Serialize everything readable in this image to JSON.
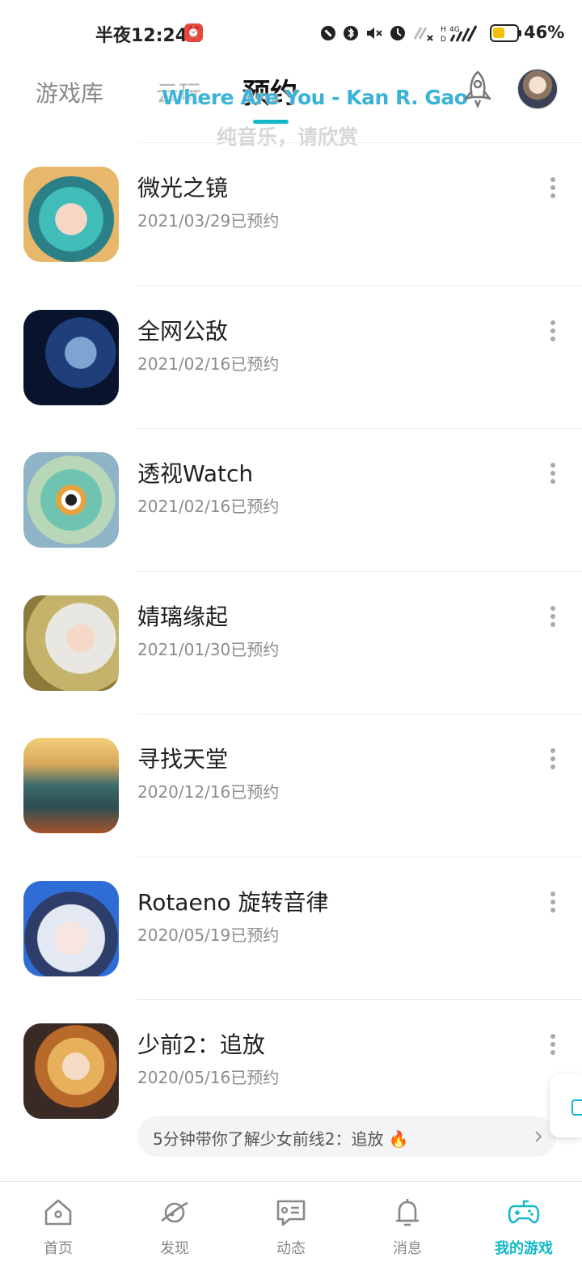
{
  "status_bar": {
    "time": "半夜12:24",
    "network": "4G",
    "battery": "46%",
    "battery_level": 0.46
  },
  "header": {
    "tabs": [
      {
        "label": "游戏库"
      },
      {
        "label": "云玩"
      },
      {
        "label": "预约",
        "active": true
      }
    ],
    "overlay": {
      "title": "Where Are You - Kan R. Gao",
      "subtitle": "纯音乐，请欣赏"
    },
    "rocket_icon": "rocket-icon",
    "avatar_icon": "user-avatar"
  },
  "games": [
    {
      "name": "微光之镜",
      "date": "2021/03/29已预约"
    },
    {
      "name": "全网公敌",
      "date": "2021/02/16已预约"
    },
    {
      "name": "透视Watch",
      "date": "2021/02/16已预约"
    },
    {
      "name": "婧璃缘起",
      "date": "2021/01/30已预约"
    },
    {
      "name": "寻找天堂",
      "date": "2020/12/16已预约"
    },
    {
      "name": "Rotaeno 旋转音律",
      "date": "2020/05/19已预约"
    },
    {
      "name": "少前2：追放",
      "date": "2020/05/16已预约"
    }
  ],
  "promo": {
    "text": "5分钟带你了解少女前线2：追放 🔥"
  },
  "bottom_nav": [
    {
      "label": "首页",
      "icon": "home-icon"
    },
    {
      "label": "发现",
      "icon": "planet-icon"
    },
    {
      "label": "动态",
      "icon": "message-square-icon"
    },
    {
      "label": "消息",
      "icon": "bell-icon"
    },
    {
      "label": "我的游戏",
      "icon": "gamepad-icon",
      "active": true
    }
  ],
  "colors": {
    "accent": "#14b9c8",
    "lyric": "#3bb3d6"
  }
}
